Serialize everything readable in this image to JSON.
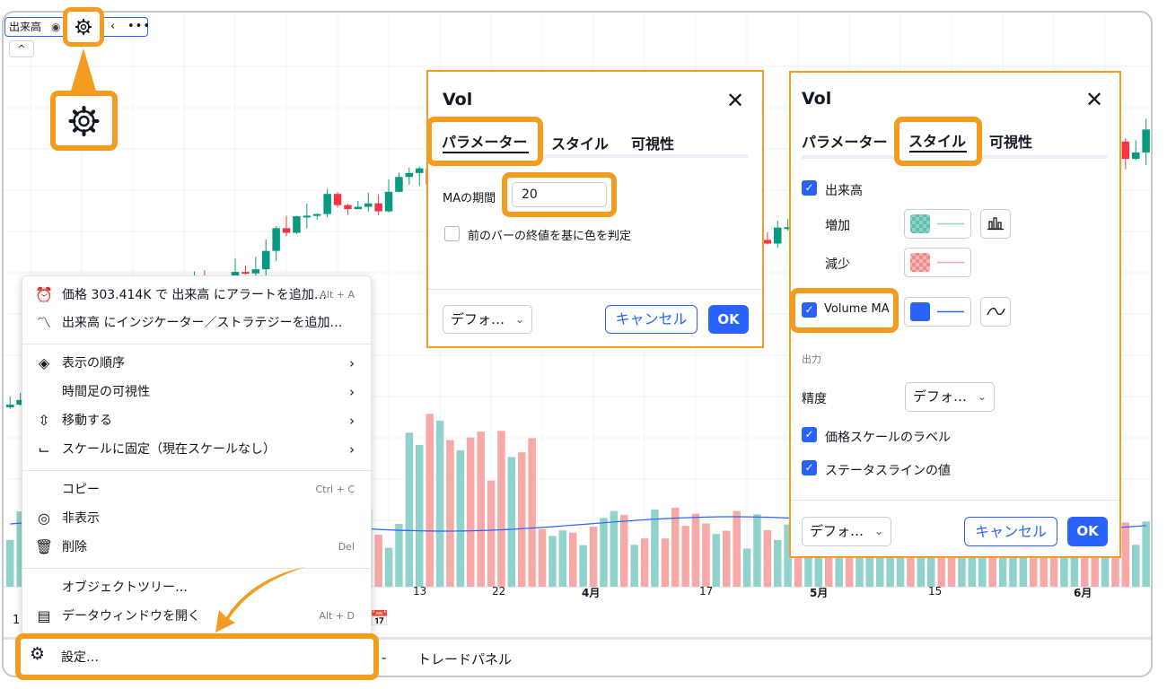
{
  "colors": {
    "accent": "#2962ff",
    "highlight": "#f39c1f",
    "candle_up": "#089981",
    "candle_down": "#f23645",
    "vol_up": "#92d2cc",
    "vol_down": "#f7a9a7",
    "ma_line": "#2962ff"
  },
  "legend": {
    "indicator": "出来高",
    "eye_icon": "eye-icon",
    "settings_icon": "gear-icon",
    "more_icon": "more-icon",
    "more_label": "•••",
    "arrow_label": "‹",
    "collapse_label": "^"
  },
  "axis": {
    "labels": [
      {
        "text": "13",
        "bold": false
      },
      {
        "text": "22",
        "bold": false
      },
      {
        "text": "4月",
        "bold": true
      },
      {
        "text": "17",
        "bold": false
      },
      {
        "text": "5月",
        "bold": true
      },
      {
        "text": "15",
        "bold": false
      },
      {
        "text": "6月",
        "bold": true
      }
    ]
  },
  "bottom": {
    "timeframe_fragment": "1",
    "calendar_icon": "calendar-icon",
    "trade_panel": "トレードパネル",
    "dash": "-"
  },
  "menu": {
    "items": [
      {
        "icon": "alarm-clock-icon",
        "glyph": "⏰",
        "label": "価格 303.414K で 出来高 にアラートを追加…",
        "shortcut": "Alt + A",
        "submenu": false
      },
      {
        "icon": "indicator-icon",
        "glyph": "〽",
        "label": "出来高 にインジケーター／ストラテジーを追加…",
        "shortcut": "",
        "submenu": false
      },
      {
        "icon": "layers-icon",
        "glyph": "◈",
        "label": "表示の順序",
        "shortcut": "",
        "submenu": true
      },
      {
        "icon": "",
        "glyph": "",
        "label": "時間足の可視性",
        "shortcut": "",
        "submenu": true
      },
      {
        "icon": "move-icon",
        "glyph": "⇳",
        "label": "移動する",
        "shortcut": "",
        "submenu": true
      },
      {
        "icon": "scale-pin-icon",
        "glyph": "⌙",
        "label": "スケールに固定（現在スケールなし）",
        "shortcut": "",
        "submenu": true
      },
      {
        "icon": "",
        "glyph": "",
        "label": "コピー",
        "shortcut": "Ctrl + C",
        "submenu": false
      },
      {
        "icon": "eye-off-icon",
        "glyph": "◎",
        "label": "非表示",
        "shortcut": "",
        "submenu": false
      },
      {
        "icon": "trash-icon",
        "glyph": "🗑",
        "label": "削除",
        "shortcut": "Del",
        "submenu": false
      },
      {
        "icon": "",
        "glyph": "",
        "label": "オブジェクトツリー…",
        "shortcut": "",
        "submenu": false
      },
      {
        "icon": "data-window-icon",
        "glyph": "▤",
        "label": "データウィンドウを開く",
        "shortcut": "Alt + D",
        "submenu": false
      },
      {
        "icon": "gear-icon",
        "glyph": "⚙",
        "label": "設定…",
        "shortcut": "",
        "submenu": false
      }
    ],
    "chevron": "›"
  },
  "dialog_params": {
    "title": "Vol",
    "close": "✕",
    "tabs": [
      "パラメーター",
      "スタイル",
      "可視性"
    ],
    "active_tab": "パラメーター",
    "ma_label": "MAの期間",
    "ma_value": "20",
    "color_option_label": "前のバーの終値を基に色を判定",
    "color_option_checked": false,
    "defaults_label": "デフォ…",
    "cancel": "キャンセル",
    "ok": "OK"
  },
  "dialog_style": {
    "title": "Vol",
    "close": "✕",
    "tabs": [
      "パラメーター",
      "スタイル",
      "可視性"
    ],
    "active_tab": "スタイル",
    "volume_label": "出来高",
    "volume_checked": true,
    "increase_label": "増加",
    "decrease_label": "減少",
    "volume_ma_label": "Volume MA",
    "volume_ma_checked": true,
    "output_label": "出力",
    "precision_label": "精度",
    "precision_value": "デフォ…",
    "price_scale_label": "価格スケールのラベル",
    "price_scale_checked": true,
    "status_line_label": "ステータスラインの値",
    "status_line_checked": true,
    "defaults_label": "デフォ…",
    "cancel": "キャンセル",
    "ok": "OK",
    "checkmark": "✓"
  }
}
